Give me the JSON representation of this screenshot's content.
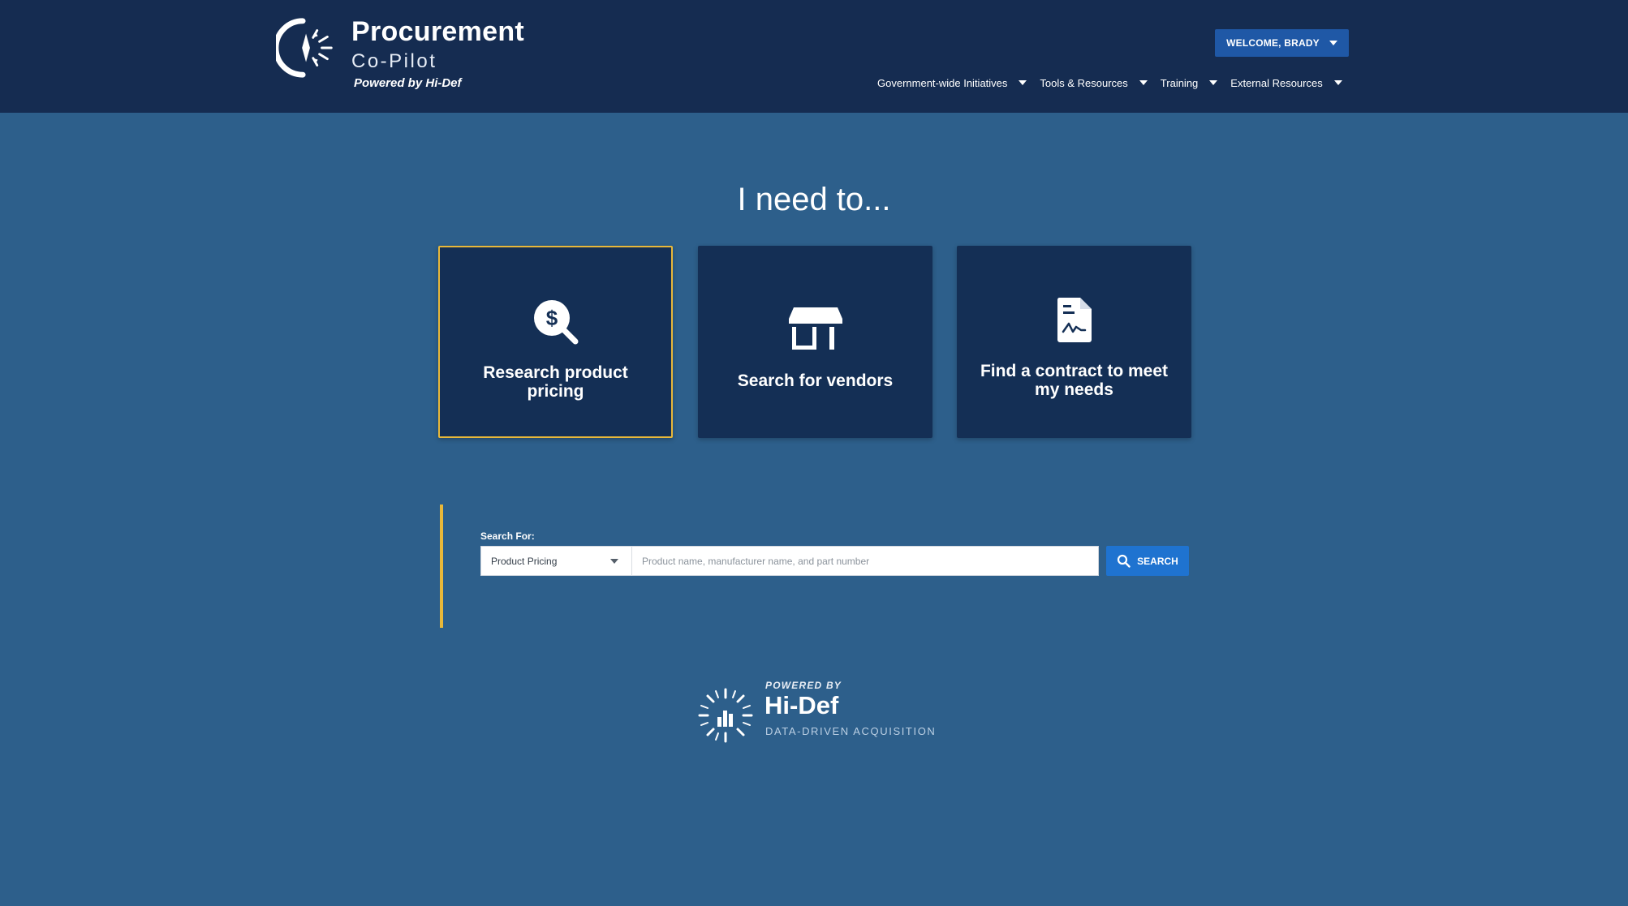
{
  "header": {
    "brand_title": "Procurement",
    "brand_subtitle": "Co-Pilot",
    "brand_powered": "Powered by Hi-Def",
    "welcome_label": "WELCOME, BRADY",
    "nav": [
      {
        "label": "Government-wide Initiatives"
      },
      {
        "label": "Tools & Resources"
      },
      {
        "label": "Training"
      },
      {
        "label": "External Resources"
      }
    ]
  },
  "main": {
    "heading": "I need to...",
    "cards": [
      {
        "label": "Research product pricing",
        "icon": "dollar-magnifier-icon",
        "selected": true
      },
      {
        "label": "Search for vendors",
        "icon": "storefront-icon",
        "selected": false
      },
      {
        "label": "Find a contract to meet my needs",
        "icon": "signed-document-icon",
        "selected": false
      }
    ]
  },
  "search": {
    "label": "Search For:",
    "selected_type": "Product Pricing",
    "placeholder": "Product name, manufacturer name, and part number",
    "value": "",
    "button_label": "SEARCH"
  },
  "footer": {
    "powered": "POWERED BY",
    "brand": "Hi-Def",
    "tagline": "DATA-DRIVEN ACQUISITION"
  },
  "colors": {
    "header_bg": "#152c51",
    "page_bg": "#2d5f8b",
    "card_bg": "#142f55",
    "accent": "#e8b83a",
    "primary_button": "#1f73d0",
    "welcome_button": "#1f58a6"
  }
}
